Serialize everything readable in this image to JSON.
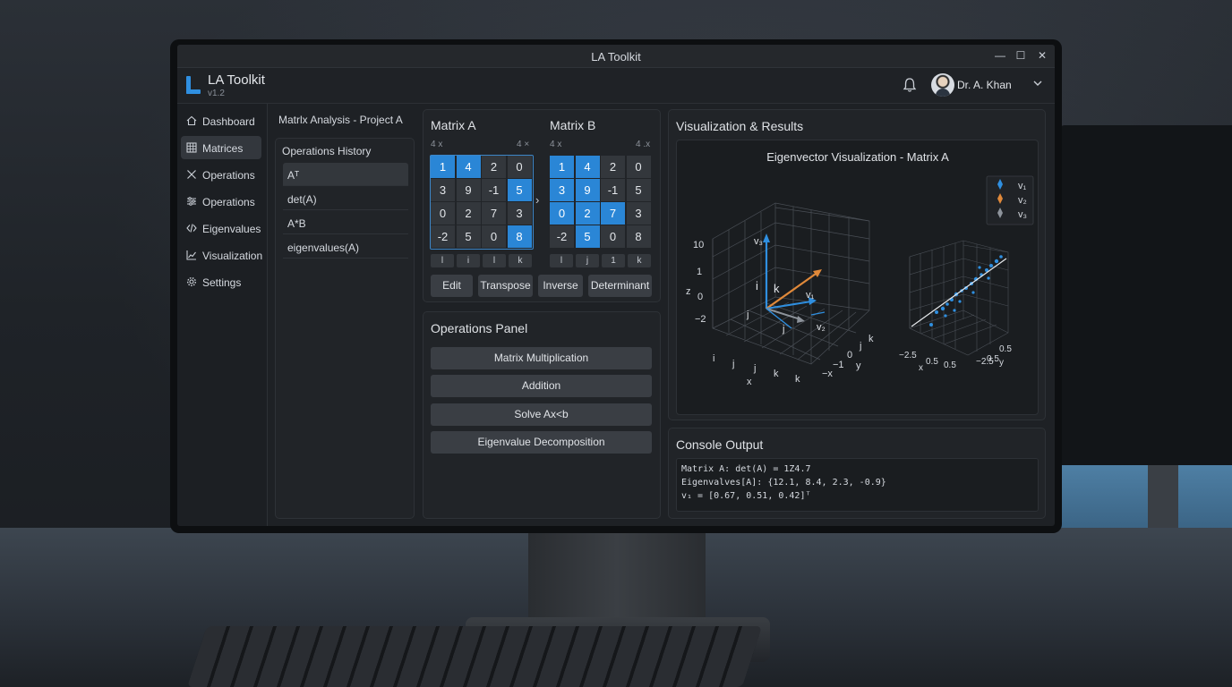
{
  "window": {
    "title": "LA Toolkit",
    "controls": {
      "minimize": "—",
      "maximize": "☐",
      "close": "✕"
    }
  },
  "app": {
    "name": "LA Toolkit",
    "version": "v1.2"
  },
  "user": {
    "name": "Dr. A. Khan"
  },
  "sidebar": {
    "items": [
      {
        "label": "Dashboard",
        "icon": "home-icon",
        "active": false
      },
      {
        "label": "Matrices",
        "icon": "grid-icon",
        "active": true
      },
      {
        "label": "Operations",
        "icon": "cross-icon",
        "active": false
      },
      {
        "label": "Operations",
        "icon": "sliders-icon",
        "active": false
      },
      {
        "label": "Eigenvalues",
        "icon": "code-icon",
        "active": false
      },
      {
        "label": "Visualization",
        "icon": "chart-icon",
        "active": false
      },
      {
        "label": "Settings",
        "icon": "gear-icon",
        "active": false
      }
    ]
  },
  "project": {
    "title": "Matrlx Analysis - Project A"
  },
  "history": {
    "title": "Operations History",
    "items": [
      "Aᵀ",
      "det(A)",
      "A*B",
      "eigenvalues(A)"
    ]
  },
  "matrix_a": {
    "title": "Matrix A",
    "rows_label": "4 x",
    "cols_label": "4 ×",
    "cells": [
      [
        "1",
        "4",
        "2",
        "0"
      ],
      [
        "3",
        "9",
        "-1",
        "5"
      ],
      [
        "0",
        "2",
        "7",
        "3"
      ],
      [
        "-2",
        "5",
        "0",
        "8"
      ]
    ],
    "highlight": [
      [
        true,
        true,
        false,
        false
      ],
      [
        false,
        false,
        false,
        true
      ],
      [
        false,
        false,
        false,
        false
      ],
      [
        false,
        false,
        false,
        true
      ]
    ],
    "index_labels": [
      "l",
      "i",
      "l",
      "k"
    ]
  },
  "matrix_b": {
    "title": "Matrix B",
    "rows_label": "4 x",
    "cols_label": "4 .x",
    "cells": [
      [
        "1",
        "4",
        "2",
        "0"
      ],
      [
        "3",
        "9",
        "-1",
        "5"
      ],
      [
        "0",
        "2",
        "7",
        "3"
      ],
      [
        "-2",
        "5",
        "0",
        "8"
      ]
    ],
    "highlight": [
      [
        true,
        true,
        false,
        false
      ],
      [
        true,
        true,
        false,
        false
      ],
      [
        true,
        true,
        true,
        false
      ],
      [
        false,
        true,
        false,
        false
      ]
    ],
    "index_labels": [
      "l",
      "j",
      "1",
      "k"
    ]
  },
  "arrow_glyph": "›",
  "matrix_buttons": [
    "Edit",
    "Transpose",
    "Inverse",
    "Determinant"
  ],
  "operations_panel": {
    "title": "Operations Panel",
    "buttons": [
      "Matrix Multiplication",
      "Addition",
      "Solve Ax<b",
      "Eigenvalue Decomposition"
    ]
  },
  "visualization": {
    "title": "Visualization & Results",
    "plot_title": "Eigenvector Visualization - Matrix A",
    "legend": [
      {
        "label": "v₁",
        "color": "#2f8fe0"
      },
      {
        "label": "v₂",
        "color": "#e0893a"
      },
      {
        "label": "v₃",
        "color": "#8d939b"
      }
    ],
    "left_axis_ticks": [
      "10",
      "1",
      "0",
      "−2"
    ],
    "left_axis_label": "z",
    "left_floor_labels": [
      "i",
      "j",
      "j",
      "k",
      "k",
      "x",
      "−x",
      "−1",
      "0",
      "y",
      "j",
      "k"
    ],
    "vector_labels": [
      "v₃",
      "i",
      "k",
      "v₁",
      "j",
      "j",
      "v₂"
    ],
    "right_floor_labels": [
      "−2.5",
      "0.5",
      "0.5",
      "x",
      "−2.5",
      "0.5",
      "y",
      "0.5"
    ]
  },
  "console": {
    "title": "Console Output",
    "lines": [
      "Matrix A: det(A) = 1Z4.7",
      "Eigenvalves[A]: {12.1, 8.4, 2.3, -0.9}",
      "v₁ = [0.67, 0.51, 0.42]ᵀ"
    ]
  }
}
